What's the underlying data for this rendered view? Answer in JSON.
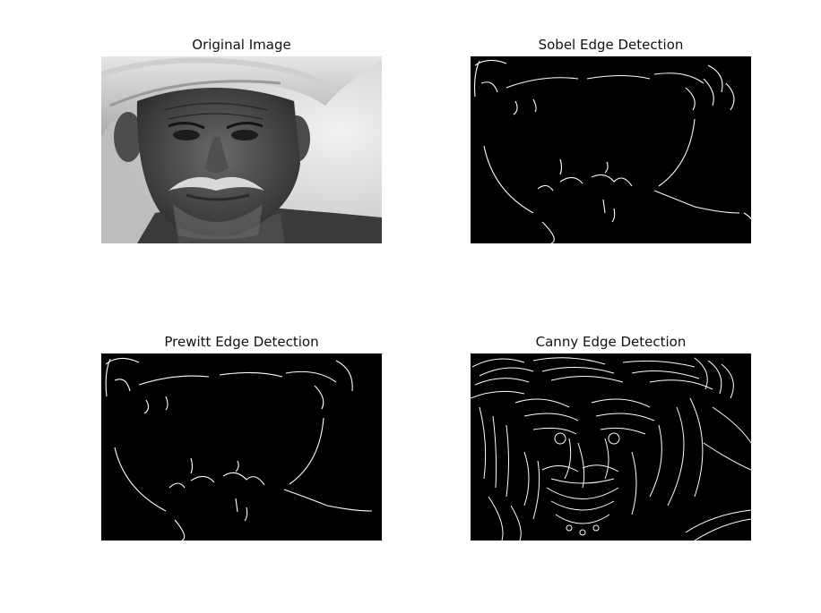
{
  "figure": {
    "panels": [
      {
        "title": "Original Image"
      },
      {
        "title": "Sobel Edge Detection"
      },
      {
        "title": "Prewitt Edge Detection"
      },
      {
        "title": "Canny Edge Detection"
      }
    ]
  }
}
